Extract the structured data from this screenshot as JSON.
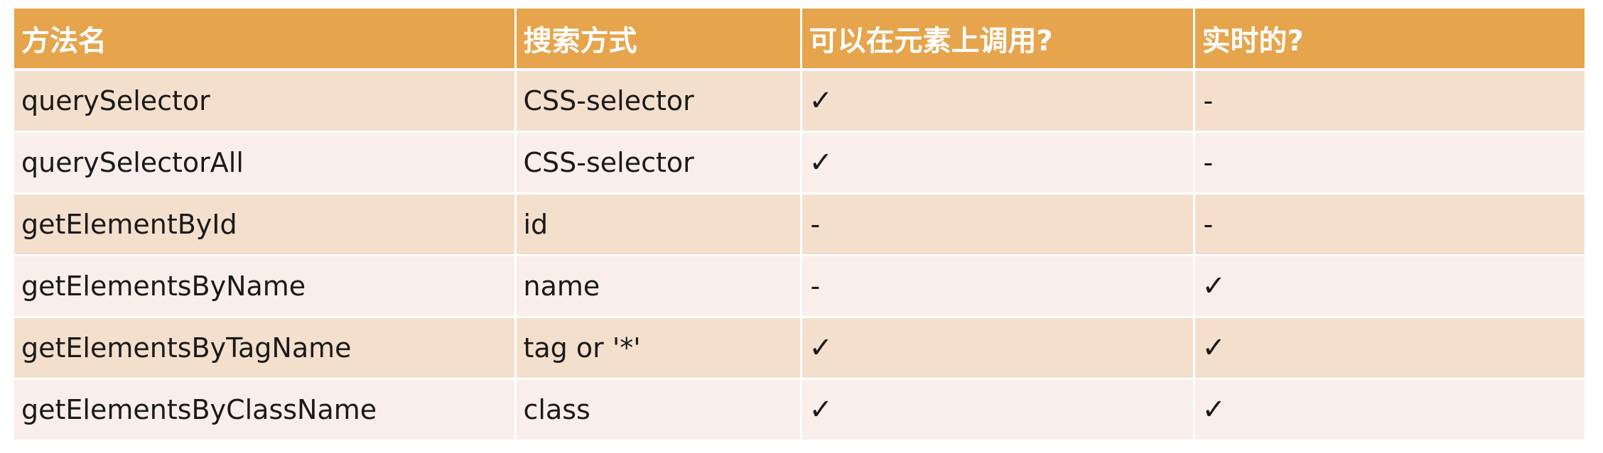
{
  "table": {
    "headers": [
      "方法名",
      "搜索方式",
      "可以在元素上调用?",
      "实时的?"
    ],
    "rows": [
      {
        "method": "querySelector",
        "search": "CSS-selector",
        "on_element": "✓",
        "live": "-"
      },
      {
        "method": "querySelectorAll",
        "search": "CSS-selector",
        "on_element": "✓",
        "live": "-"
      },
      {
        "method": "getElementById",
        "search": "id",
        "on_element": "-",
        "live": "-"
      },
      {
        "method": "getElementsByName",
        "search": "name",
        "on_element": "-",
        "live": "✓"
      },
      {
        "method": "getElementsByTagName",
        "search": "tag or '*'",
        "on_element": "✓",
        "live": "✓"
      },
      {
        "method": "getElementsByClassName",
        "search": "class",
        "on_element": "✓",
        "live": "✓"
      }
    ]
  },
  "colors": {
    "header_bg": "#e6a44c",
    "header_text": "#ffffff",
    "row_odd_bg": "#f4dfcd",
    "row_even_bg": "#f9eeea",
    "text": "#1a1a1a"
  }
}
